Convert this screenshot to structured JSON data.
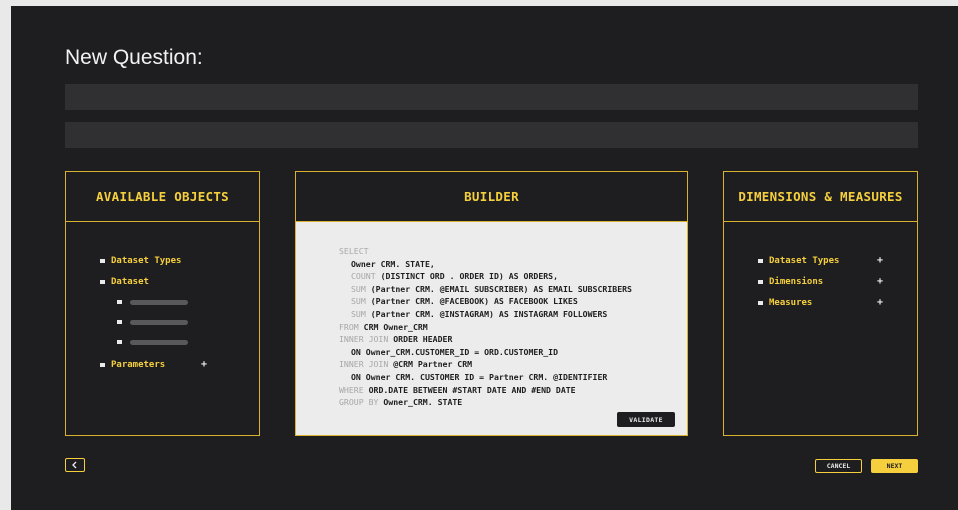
{
  "page_title": "New Question:",
  "colors": {
    "accent": "#f5cf3d",
    "background": "#1e1e20",
    "builder_bg": "#ececec"
  },
  "available_objects": {
    "heading": "AVAILABLE OBJECTS",
    "items": [
      {
        "label": "Dataset Types"
      },
      {
        "label": "Dataset"
      },
      {
        "label": "Parameters",
        "action": "+"
      }
    ]
  },
  "builder": {
    "heading": "BUILDER",
    "sql": [
      {
        "kw": "SELECT",
        "text": "",
        "indent": 0
      },
      {
        "kw": "",
        "text": "Owner CRM. STATE,",
        "indent": 1
      },
      {
        "kw": "COUNT",
        "text": " (DISTINCT ORD . ORDER ID) AS ORDERS,",
        "indent": 2
      },
      {
        "kw": "SUM",
        "text": " (Partner CRM. @EMAIL SUBSCRIBER) AS EMAIL SUBSCRIBERS",
        "indent": 2
      },
      {
        "kw": "SUM",
        "text": " (Partner CRM. @FACEBOOK) AS FACEBOOK LIKES",
        "indent": 2
      },
      {
        "kw": "SUM",
        "text": " (Partner CRM. @INSTAGRAM) AS INSTAGRAM FOLLOWERS",
        "indent": 2
      },
      {
        "kw": "FROM",
        "text": " CRM Owner_CRM",
        "indent": 0
      },
      {
        "kw": "INNER JOIN",
        "text": " ORDER HEADER",
        "indent": 0
      },
      {
        "kw": "",
        "text": "ON Owner_CRM.CUSTOMER_ID = ORD.CUSTOMER_ID",
        "indent": 1
      },
      {
        "kw": "INNER JOIN",
        "text": " @CRM Partner CRM",
        "indent": 0
      },
      {
        "kw": "",
        "text": "ON Owner CRM. CUSTOMER ID = Partner CRM. @IDENTIFIER",
        "indent": 1
      },
      {
        "kw": "WHERE",
        "text": " ORD.DATE BETWEEN #START DATE AND #END DATE",
        "indent": 0
      },
      {
        "kw": "GROUP BY",
        "text": " Owner_CRM. STATE",
        "indent": 0
      }
    ],
    "validate_label": "VALIDATE"
  },
  "dimensions_measures": {
    "heading": "DIMENSIONS & MEASURES",
    "items": [
      {
        "label": "Dataset Types",
        "action": "+"
      },
      {
        "label": "Dimensions",
        "action": "+"
      },
      {
        "label": "Measures",
        "action": "+"
      }
    ]
  },
  "footer": {
    "back_icon": "chevron-left-icon",
    "cancel_label": "CANCEL",
    "next_label": "NEXT"
  }
}
